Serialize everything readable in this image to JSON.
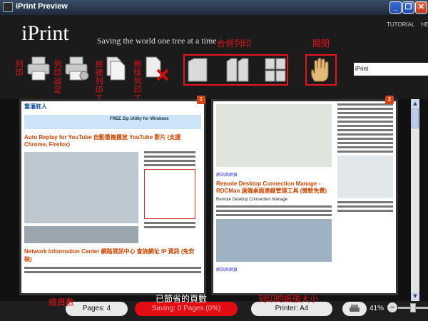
{
  "window": {
    "title": "iPrint Preview",
    "minimize": "_",
    "maximize": "❐",
    "close": "✕"
  },
  "header": {
    "logo": "iPrint",
    "tagline": "Saving the world one tree at a time",
    "nav": {
      "tutorial": "TUTORIAL",
      "help": "HE"
    },
    "search_value": "iPrint"
  },
  "toolbar": {
    "print_label": "列印",
    "print_settings_label": "列印設定",
    "preview_print_label": "檢視列印工作",
    "delete_print_label": "刪除列印工作",
    "merge_label": "合併列印",
    "close_label": "關閉"
  },
  "pages": {
    "page1": {
      "badge": "1",
      "site_title": "重灌狂人",
      "ad_title": "FREE Zip Utility for Windows",
      "article1": "Auto Replay for YouTube 自動重複播放 YouTube 影片 (支援Chrome, Firefox)",
      "article2": "Network Information Center 網路資訊中心 查詢網址 IP 資訊 (免安裝)"
    },
    "page2": {
      "badge": "2",
      "link1": "網站與網頁",
      "article1": "Remote Desktop Connection Manage - RDCMan 遠端桌面連線管理工具 (微軟免費)",
      "article1_body": "Remote Desktop Connection Manage",
      "link2": "網站與網頁"
    }
  },
  "statusbar": {
    "total_pages_label": "總頁數",
    "pages_text": "Pages: 4",
    "saved_pages_label": "已節省的頁數",
    "saving_text": "Saving: 0 Pages (0%)",
    "paper_size_label": "列印的紙張大小",
    "printer_text": "Printer: A4",
    "zoom_text": "41%",
    "zoom_minus": "–"
  },
  "colors": {
    "annotation_red": "#e8141c",
    "saving_red": "#e10d13",
    "badge_orange": "#d54415"
  }
}
